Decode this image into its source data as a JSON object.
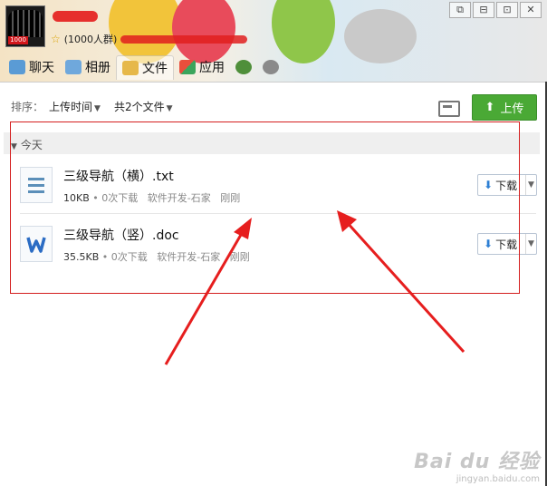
{
  "header": {
    "group_count": "(1000人群)",
    "tabs": [
      {
        "label": "聊天",
        "icon": "chat-icon"
      },
      {
        "label": "相册",
        "icon": "album-icon"
      },
      {
        "label": "文件",
        "icon": "folder-icon"
      },
      {
        "label": "应用",
        "icon": "apps-icon"
      }
    ],
    "window_buttons": [
      "⧉",
      "⊟",
      "⊡",
      "✕"
    ]
  },
  "toolbar": {
    "sort_label": "排序：",
    "sort_value": "上传时间",
    "file_count": "共2个文件",
    "upload_label": "上传"
  },
  "section": {
    "title": "今天"
  },
  "files": [
    {
      "name": "三级导航（横）.txt",
      "size": "10KB",
      "downloads": "0次下载",
      "uploader": "软件开发-石家",
      "time": "刚刚",
      "download_label": "下载",
      "icon": "txt-file-icon"
    },
    {
      "name": "三级导航（竖）.doc",
      "size": "35.5KB",
      "downloads": "0次下载",
      "uploader": "软件开发-石家",
      "time": "刚刚",
      "download_label": "下载",
      "icon": "word-file-icon"
    }
  ],
  "watermark": {
    "main": "Bai du 经验",
    "sub": "jingyan.baidu.com"
  },
  "colors": {
    "upload": "#4aa935",
    "annotation": "#d41e1e",
    "accent": "#2d7fd4"
  }
}
